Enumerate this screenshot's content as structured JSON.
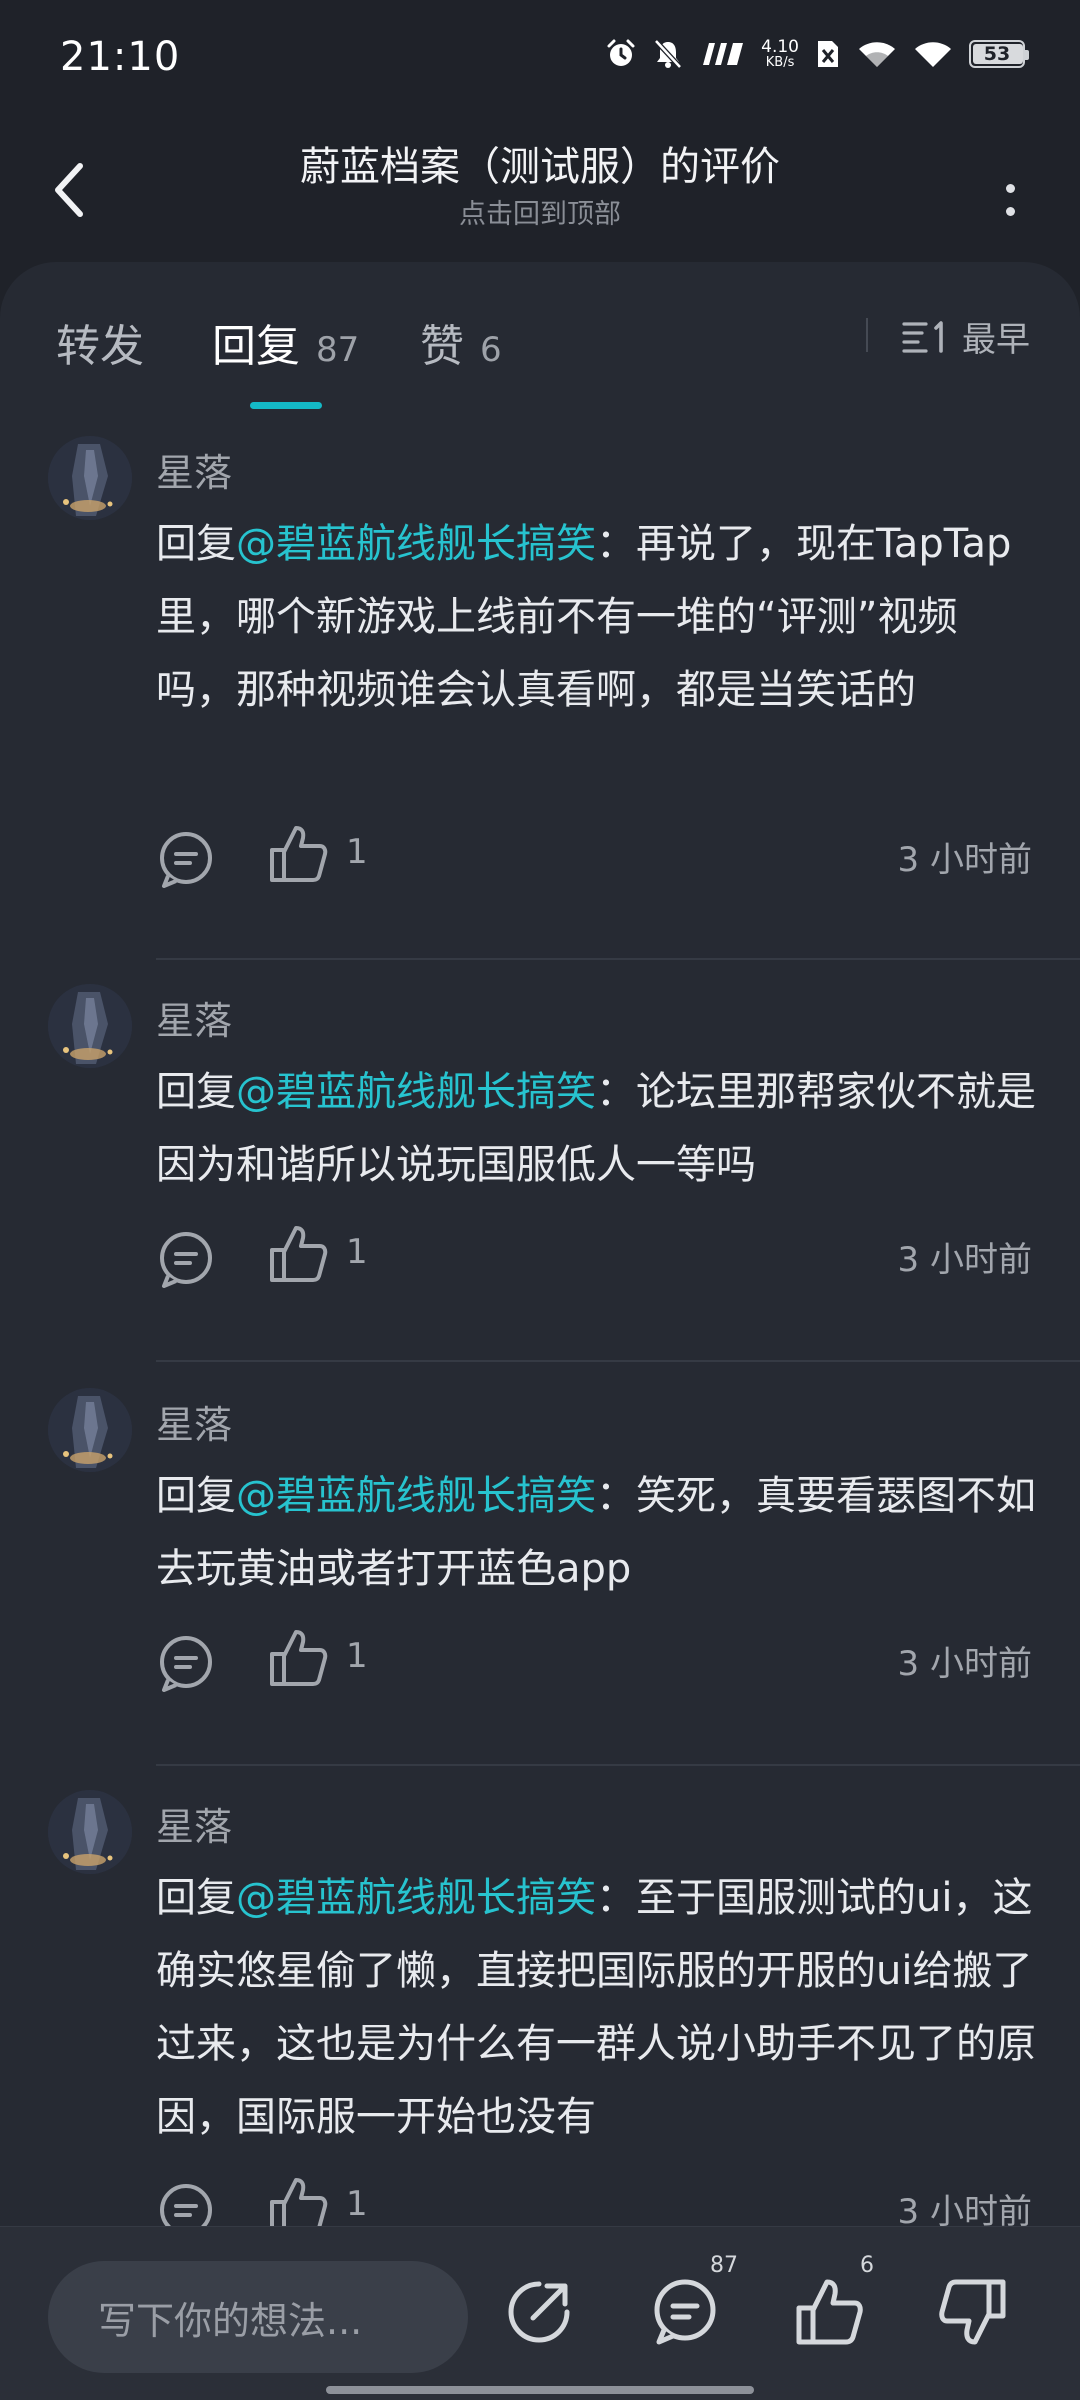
{
  "status_bar": {
    "time": "21:10",
    "net_speed_value": "4.10",
    "net_speed_unit": "KB/s",
    "battery": "53",
    "icons": [
      "alarm-icon",
      "mute-bell-icon",
      "hd-signal-icon",
      "net-speed",
      "sim-off-icon",
      "wifi-icon",
      "wifi-icon",
      "battery-icon"
    ]
  },
  "header": {
    "title": "蔚蓝档案（测试服）的评价",
    "subtitle": "点击回到顶部"
  },
  "tabs": [
    {
      "label": "转发",
      "count": ""
    },
    {
      "label": "回复",
      "count": "87"
    },
    {
      "label": "赞",
      "count": "6"
    }
  ],
  "active_tab": "回复",
  "sort": {
    "label": "最早"
  },
  "comments": [
    {
      "username": "星落",
      "reply_prefix": "回复",
      "mention": "@碧蓝航线舰长搞笑",
      "body": "：再说了，现在TapTap里，哪个新游戏上线前不有一堆的“评测”视频吗，那种视频谁会认真看啊，都是当笑话的",
      "likes": "1",
      "time": "3 小时前"
    },
    {
      "username": "星落",
      "reply_prefix": "回复",
      "mention": "@碧蓝航线舰长搞笑",
      "body": "：论坛里那帮家伙不就是因为和谐所以说玩国服低人一等吗",
      "likes": "1",
      "time": "3 小时前"
    },
    {
      "username": "星落",
      "reply_prefix": "回复",
      "mention": "@碧蓝航线舰长搞笑",
      "body": "：笑死，真要看瑟图不如去玩黄油或者打开蓝色app",
      "likes": "1",
      "time": "3 小时前"
    },
    {
      "username": "星落",
      "reply_prefix": "回复",
      "mention": "@碧蓝航线舰长搞笑",
      "body": "：至于国服测试的ui，这确实悠星偷了懒，直接把国际服的开服的ui给搬了过来，这也是为什么有一群人说小助手不见了的原因，国际服一开始也没有",
      "likes": "1",
      "time": "3 小时前"
    }
  ],
  "bottom_bar": {
    "input_placeholder": "写下你的想法...",
    "reply_count": "87",
    "like_count": "6"
  },
  "colors": {
    "background": "#1f2229",
    "panel": "#262a33",
    "accent": "#14b9c6",
    "mention": "#27c3cf"
  }
}
